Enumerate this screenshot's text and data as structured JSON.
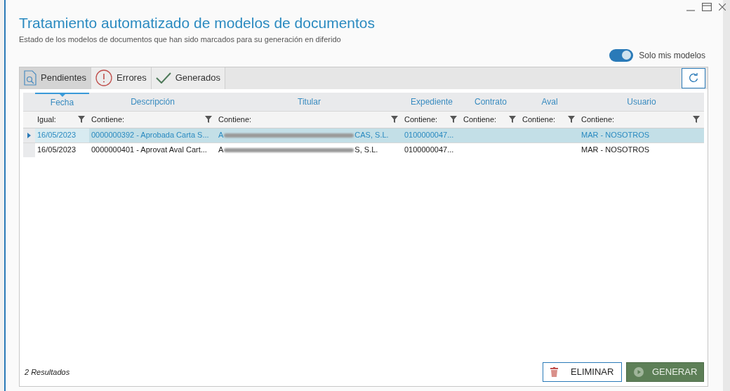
{
  "window": {
    "title": "Tratamiento automatizado de modelos de documentos",
    "subtitle": "Estado de  los modelos de documentos que han sido marcados para su generación en diferido"
  },
  "toggle": {
    "label": "Solo mis modelos",
    "on": true
  },
  "tabs": [
    {
      "label": "Pendientes",
      "kind": "pending",
      "selected": true
    },
    {
      "label": "Errores",
      "kind": "error",
      "selected": false
    },
    {
      "label": "Generados",
      "kind": "done",
      "selected": false
    }
  ],
  "table": {
    "columns": [
      {
        "label": "Fecha",
        "filter": "Igual:",
        "sorted": true
      },
      {
        "label": "Descripción",
        "filter": "Contiene:",
        "sorted": false
      },
      {
        "label": "Titular",
        "filter": "Contiene:",
        "sorted": false
      },
      {
        "label": "Expediente",
        "filter": "Contiene:",
        "sorted": false
      },
      {
        "label": "Contrato",
        "filter": "Contiene:",
        "sorted": false
      },
      {
        "label": "Aval",
        "filter": "Contiene:",
        "sorted": false
      },
      {
        "label": "Usuario",
        "filter": "Contiene:",
        "sorted": false
      }
    ],
    "rows": [
      {
        "selected": true,
        "fecha": "16/05/2023",
        "descripcion": "0000000392 - Aprobada Carta S...",
        "titular_start": "A",
        "titular_end": "CAS, S.L.",
        "expediente": "0100000047...",
        "usuario": "MAR - NOSOTROS"
      },
      {
        "selected": false,
        "fecha": "16/05/2023",
        "descripcion": "0000000401 - Aprovat Aval Cart...",
        "titular_start": "A",
        "titular_end": "S, S.L.",
        "expediente": "0100000047...",
        "usuario": "MAR - NOSOTROS"
      }
    ]
  },
  "status": "2 Resultados",
  "buttons": [
    {
      "label": "ELIMINAR",
      "kind": "delete"
    },
    {
      "label": "GENERAR",
      "kind": "generate"
    }
  ]
}
